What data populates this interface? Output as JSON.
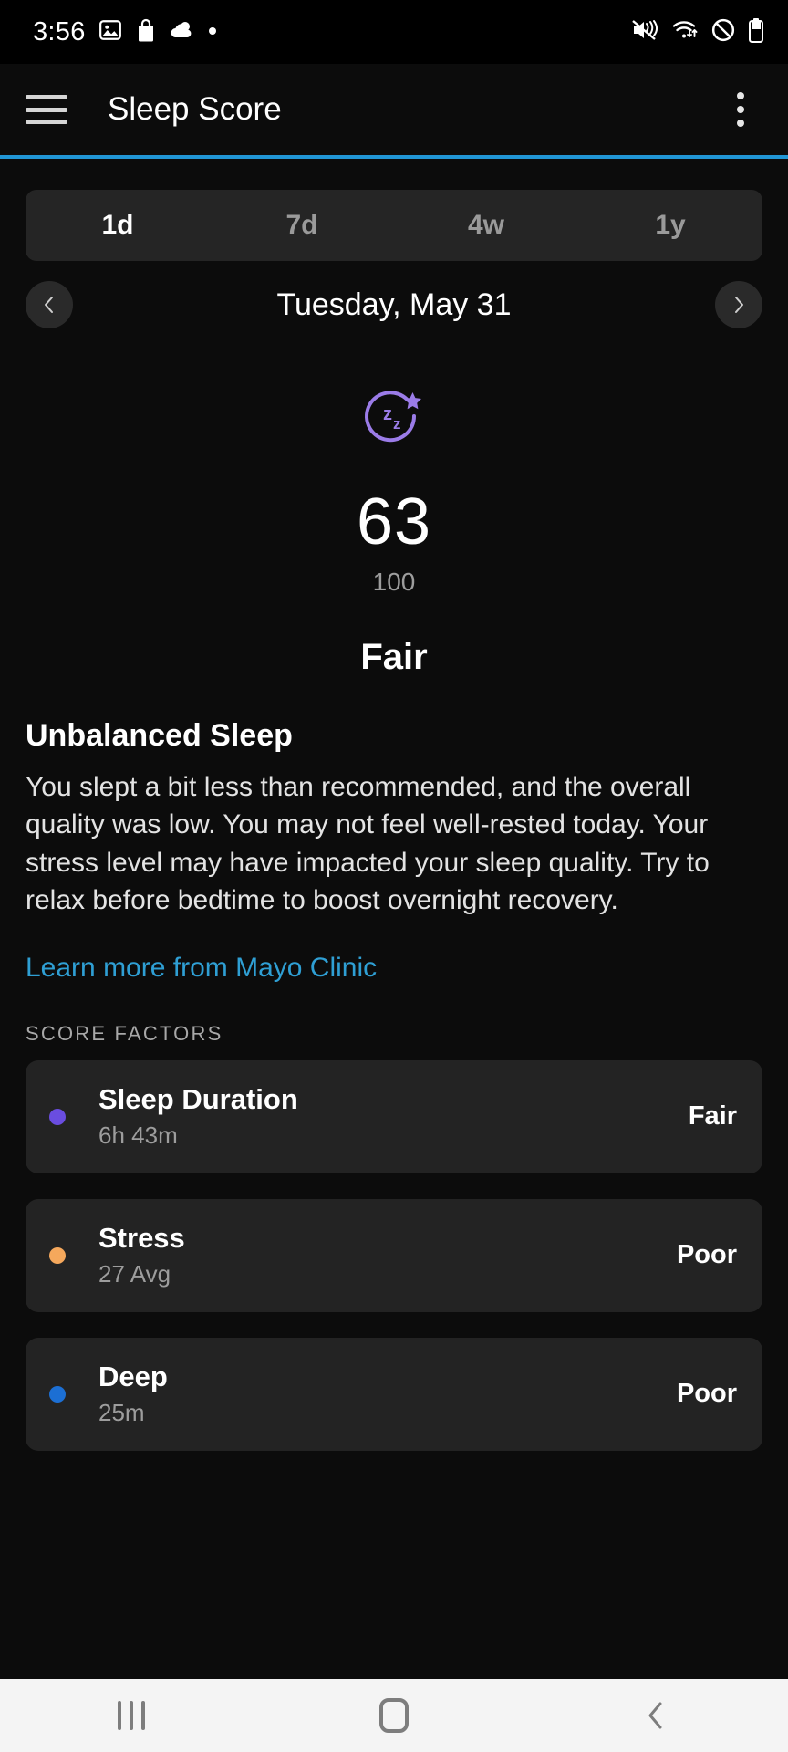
{
  "status_bar": {
    "time": "3:56",
    "left_icons": [
      "photo-icon",
      "shopping-bag-icon",
      "weather-cloud-icon",
      "dot-icon"
    ],
    "right_icons": [
      "vibrate-mute-icon",
      "wifi-data-icon",
      "do-not-disturb-icon",
      "battery-icon"
    ]
  },
  "app_bar": {
    "menu_icon": "hamburger-menu-icon",
    "title": "Sleep Score",
    "overflow_icon": "kebab-menu-icon",
    "accent_color": "#2196d6"
  },
  "range_tabs": {
    "items": [
      {
        "label": "1d",
        "selected": true
      },
      {
        "label": "7d",
        "selected": false
      },
      {
        "label": "4w",
        "selected": false
      },
      {
        "label": "1y",
        "selected": false
      }
    ]
  },
  "date_nav": {
    "prev_icon": "chevron-left-icon",
    "date": "Tuesday, May 31",
    "next_icon": "chevron-right-icon"
  },
  "score": {
    "icon": "sleep-zz-star-icon",
    "icon_color": "#9b7ce8",
    "value": "63",
    "max": "100",
    "label": "Fair"
  },
  "description": {
    "title": "Unbalanced Sleep",
    "body": "You slept a bit less than recommended, and the overall quality was low. You may not feel well-rested today. Your stress level may have impacted your sleep quality. Try to relax before bedtime to boost overnight recovery.",
    "link": "Learn more from Mayo Clinic",
    "link_color": "#2f9fd4"
  },
  "score_factors": {
    "heading": "SCORE FACTORS",
    "items": [
      {
        "name": "Sleep Duration",
        "value": "6h 43m",
        "rating": "Fair",
        "color": "#6a4de0"
      },
      {
        "name": "Stress",
        "value": "27 Avg",
        "rating": "Poor",
        "color": "#f5a85c"
      },
      {
        "name": "Deep",
        "value": "25m",
        "rating": "Poor",
        "color": "#1c6fd4"
      }
    ]
  },
  "nav_bar": {
    "recents_icon": "recents-icon",
    "home_icon": "home-icon",
    "back_icon": "back-icon"
  }
}
